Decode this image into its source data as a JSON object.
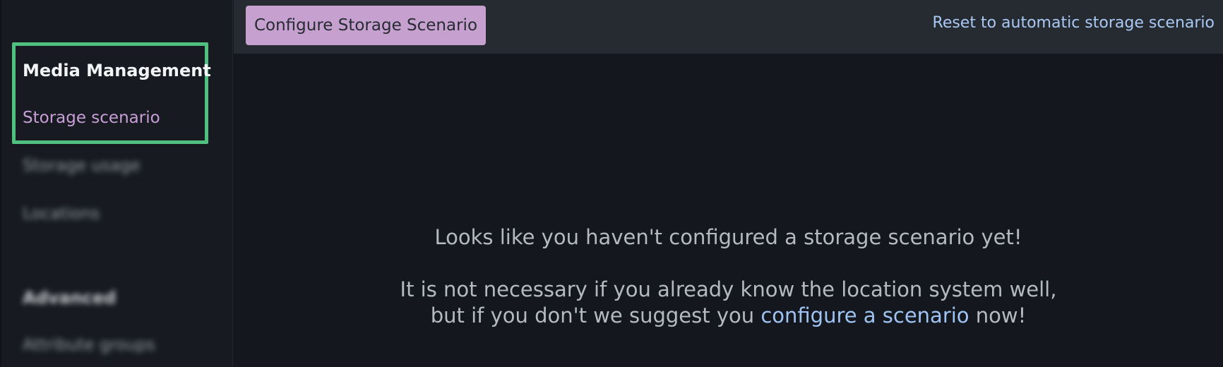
{
  "sidebar": {
    "section_title": "Media Management",
    "items": [
      {
        "label": "Storage scenario",
        "active": true
      },
      {
        "label": "Storage usage",
        "active": false
      },
      {
        "label": "Locations",
        "active": false
      }
    ],
    "section2_title": "Advanced",
    "section2_items": [
      {
        "label": "Attribute groups"
      }
    ]
  },
  "toolbar": {
    "configure_label": "Configure Storage Scenario",
    "reset_label": "Reset to automatic storage scenario"
  },
  "empty_state": {
    "title": "Looks like you haven't configured a storage scenario yet!",
    "line1": "It is not necessary if you already know the location system well,",
    "line2_prefix": "but if you don't we suggest you ",
    "link_label": "configure a scenario",
    "line2_suffix": " now!"
  },
  "colors": {
    "accent": "#c6a0cf",
    "highlight": "#4fc07e",
    "link": "#a9c9f4",
    "background": "#14181e"
  }
}
